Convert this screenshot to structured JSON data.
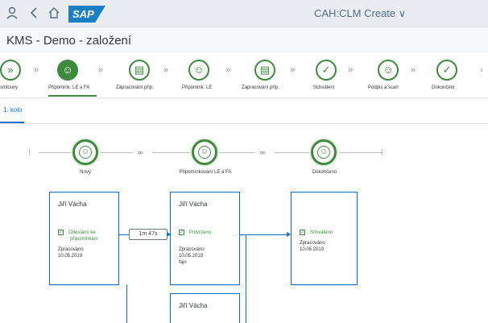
{
  "shell": {
    "user_icon": "user-icon",
    "back_icon": "chevron-left-icon",
    "home_icon": "home-icon",
    "logo_text": "SAP",
    "app_title": "CAH:CLM Create ∨"
  },
  "header": {
    "title": "KMS - Demo - založení"
  },
  "steps": [
    {
      "label": "smlouvy",
      "icon": "forward-icon",
      "active": false
    },
    {
      "label": "Připomink. LE a FA",
      "icon": "user-edit-icon",
      "active": true
    },
    {
      "label": "Zapracování přip.",
      "icon": "document-icon",
      "active": false
    },
    {
      "label": "Připomink. LE",
      "icon": "user-edit-icon",
      "active": false
    },
    {
      "label": "Zapracování přip.",
      "icon": "document-icon",
      "active": false
    },
    {
      "label": "Schválení",
      "icon": "check-icon",
      "active": false
    },
    {
      "label": "Podpis a scan",
      "icon": "group-icon",
      "active": false
    },
    {
      "label": "Dokončení",
      "icon": "check-icon",
      "active": false
    }
  ],
  "step_separator": "»",
  "tab": {
    "label": "1. kolo"
  },
  "flow": {
    "nodes": [
      {
        "label": "Nový"
      },
      {
        "label": "Připomínkování LE a FA"
      },
      {
        "label": "Dokončeno"
      }
    ],
    "chevron": "»»",
    "cards": [
      {
        "name": "Jiří Vácha",
        "status_line1": "Odesláno ke",
        "status_line2": "připomínkám",
        "meta1": "Zpracováno",
        "meta2": "10.05.2019",
        "meta3": ""
      },
      {
        "name": "Jiří Vácha",
        "status_line1": "Potvrzeno",
        "status_line2": "",
        "meta1": "Zpracováno",
        "meta2": "10.05.2019",
        "meta3": "fajn"
      },
      {
        "name": "Jiří Vácha",
        "status_line1": "Schváleno",
        "status_line2": "",
        "meta1": "Zpracováno",
        "meta2": "10.05.2019",
        "meta3": ""
      },
      {
        "name": "Jiří Vácha"
      }
    ],
    "duration": "1m 47s"
  },
  "colors": {
    "accent": "#0a6ed1",
    "positive": "#3e8a3f",
    "shell_bg": "#e9edf2"
  }
}
